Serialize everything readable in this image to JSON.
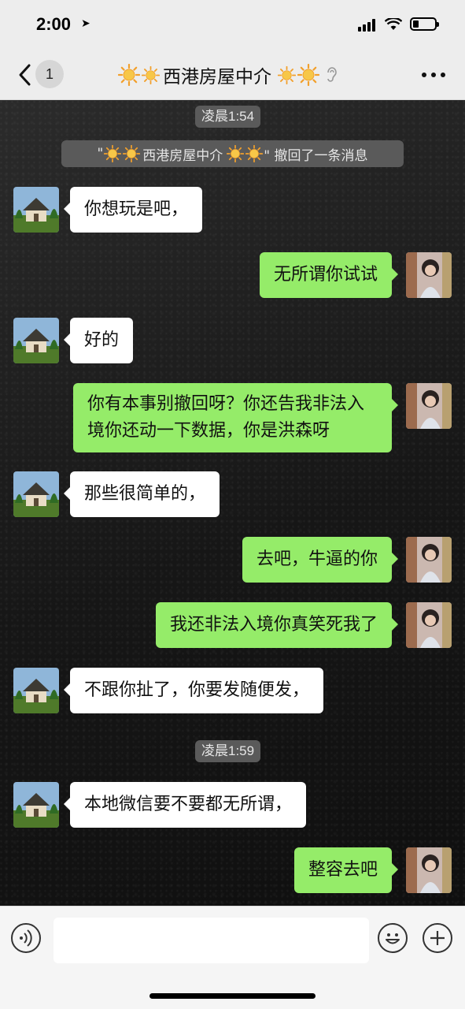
{
  "status_bar": {
    "time": "2:00"
  },
  "header": {
    "back_count": "1",
    "title": "西港房屋中介"
  },
  "chat": {
    "timestamps": [
      "凌晨1:54",
      "凌晨1:59"
    ],
    "recall_notice": {
      "quote_open": "\"",
      "name": "西港房屋中介",
      "suffix": "\" 撤回了一条消息"
    },
    "messages": [
      {
        "side": "in",
        "text": "你想玩是吧，"
      },
      {
        "side": "out",
        "text": "无所谓你试试"
      },
      {
        "side": "in",
        "text": "好的"
      },
      {
        "side": "out",
        "text": "你有本事别撤回呀？你还告我非法入境你还动一下数据，你是洪森呀"
      },
      {
        "side": "in",
        "text": "那些很简单的，"
      },
      {
        "side": "out",
        "text": "去吧，牛逼的你"
      },
      {
        "side": "out",
        "text": "我还非法入境你真笑死我了"
      },
      {
        "side": "in",
        "text": "不跟你扯了，你要发随便发，"
      },
      {
        "side": "in",
        "text": "本地微信要不要都无所谓，"
      },
      {
        "side": "out",
        "text": "整容去吧"
      }
    ]
  },
  "colors": {
    "outgoing_bubble": "#95ec69",
    "incoming_bubble": "#ffffff",
    "chat_background": "#1a1a1a",
    "bar_background": "#ededed"
  },
  "icons": {
    "header_decor": "sun-icon",
    "earpiece_mode": "ear-icon",
    "input_left": "voice-icon",
    "input_right_1": "emoji-icon",
    "input_right_2": "plus-icon"
  }
}
